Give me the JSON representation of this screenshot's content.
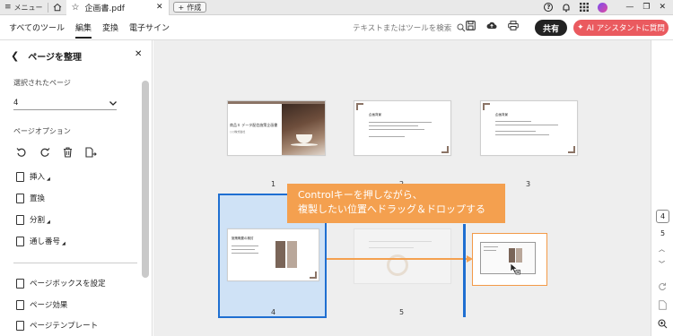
{
  "titlebar": {
    "menu_label": "メニュー",
    "tab_title": "企画書.pdf",
    "create_label": "作成",
    "icons": [
      "hamburger-icon",
      "home-icon",
      "star-icon",
      "close-icon",
      "help-icon",
      "bell-icon",
      "apps-grid-icon",
      "avatar"
    ]
  },
  "menubar": {
    "items": [
      "すべてのツール",
      "編集",
      "変換",
      "電子サイン"
    ],
    "active": "編集",
    "search_placeholder": "テキストまたはツールを検索",
    "share_label": "共有",
    "ai_label": "AI アシスタントに質問"
  },
  "leftpanel": {
    "title": "ページを整理",
    "selected_pages_label": "選択されたページ",
    "selected_pages_value": "4",
    "page_options_label": "ページオプション",
    "actions": [
      "挿入",
      "置換",
      "分割",
      "通し番号"
    ],
    "bottom_actions": [
      "ページボックスを設定",
      "ページ効果",
      "ページテンプレート"
    ]
  },
  "canvas": {
    "page_numbers": [
      "1",
      "2",
      "3",
      "4",
      "5"
    ],
    "callout_line1": "Controlキーを押しながら、",
    "callout_line2": "複製したい位置へドラッグ＆ドロップする",
    "slide1_title": "商品Ｘ データ配信施策企画書",
    "slide1_sub": "○○株式会社",
    "slide_heading_2": "企画背景",
    "slide_heading_3": "企画背景",
    "slide_heading_4": "施策概要の検討"
  },
  "rightrail": {
    "current_page": "4",
    "next_page": "5"
  },
  "colors": {
    "accent_blue": "#1f6fd1",
    "callout_orange": "#f4a04f",
    "ai_button": "#ea5a5f"
  }
}
